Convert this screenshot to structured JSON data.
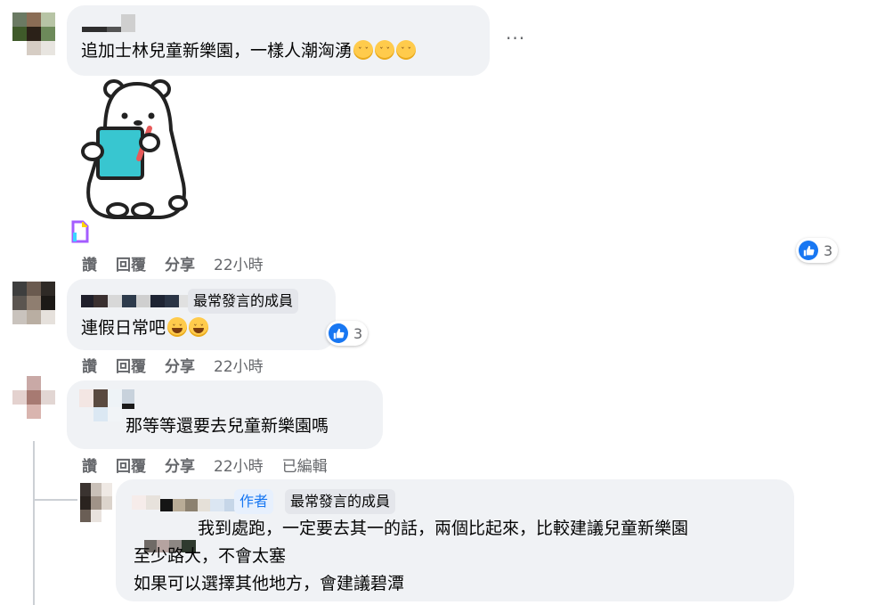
{
  "comments": [
    {
      "text": "追加士林兒童新樂園，一樣人潮洶湧",
      "emojis": [
        "thinking-face",
        "thinking-face",
        "thinking-face"
      ],
      "sticker": "polar-bear-holding-notebook-sticker",
      "actions": {
        "like": "讚",
        "reply": "回覆",
        "share": "分享",
        "time": "22小時"
      },
      "reactions": {
        "icon": "like-icon",
        "count": "3"
      }
    },
    {
      "badge": "最常發言的成員",
      "text": "連假日常吧",
      "emojis": [
        "rolling-laughing-face",
        "rolling-laughing-face"
      ],
      "actions": {
        "like": "讚",
        "reply": "回覆",
        "share": "分享",
        "time": "22小時"
      },
      "reactions": {
        "icon": "like-icon",
        "count": "3"
      }
    },
    {
      "text": "那等等還要去兒童新樂園嗎",
      "actions": {
        "like": "讚",
        "reply": "回覆",
        "share": "分享",
        "time": "22小時",
        "edited": "已編輯"
      }
    }
  ],
  "reply": {
    "author_badge": "作者",
    "badge": "最常發言的成員",
    "lines": [
      "我到處跑，一定要去其一的話，兩個比起來，比較建議兒童新樂園",
      "至少路大，不會太塞",
      "如果可以選擇其他地方，會建議碧潭"
    ]
  },
  "more_icon": "more-options-icon",
  "colors": {
    "bubble": "#f0f2f5",
    "like": "#1877f2",
    "meta": "#65676b",
    "thread": "#ccd0d5"
  }
}
